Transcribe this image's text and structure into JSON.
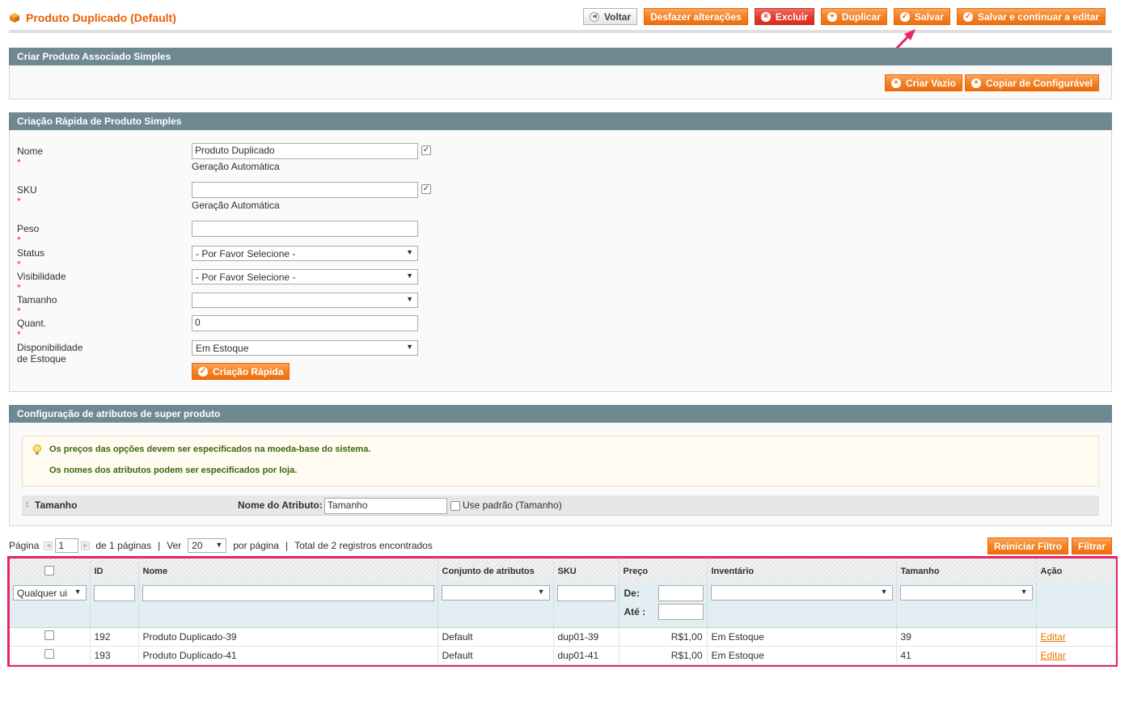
{
  "header": {
    "title": "Produto Duplicado (Default)",
    "buttons": {
      "back": "Voltar",
      "reset": "Desfazer alterações",
      "delete": "Excluir",
      "duplicate": "Duplicar",
      "save": "Salvar",
      "save_continue": "Salvar e continuar a editar"
    }
  },
  "associated": {
    "title": "Criar Produto Associado Simples",
    "create_empty": "Criar Vazio",
    "copy_configurable": "Copiar de Configurável"
  },
  "quick": {
    "title": "Criação Rápida de Produto Simples",
    "required_mark": "*",
    "name_label": "Nome",
    "name_value": "Produto Duplicado",
    "auto_gen": "Geração Automática",
    "sku_label": "SKU",
    "sku_value": "",
    "weight_label": "Peso",
    "status_label": "Status",
    "status_value": "- Por Favor Selecione -",
    "visibility_label": "Visibilidade",
    "visibility_value": "- Por Favor Selecione -",
    "size_label": "Tamanho",
    "size_value": "",
    "qty_label": "Quant.",
    "qty_value": "0",
    "stock_label": "Disponibilidade de Estoque",
    "stock_value": "Em Estoque",
    "submit": "Criação Rápida"
  },
  "super": {
    "title": "Configuração de atributos de super produto",
    "notice_1": "Os preços das opções devem ser especificados na moeda-base do sistema.",
    "notice_2": "Os nomes dos atributos podem ser especificados por loja.",
    "attr_name": "Tamanho",
    "attr_label_caption": "Nome do Atributo:",
    "attr_label_value": "Tamanho",
    "use_default": "Use padrão (Tamanho)"
  },
  "pager": {
    "page_label": "Página",
    "page_value": "1",
    "of_pages": "de 1 páginas",
    "sep": "|",
    "view_label": "Ver",
    "per_page_value": "20",
    "per_page": "por página",
    "total": "Total de 2 registros encontrados",
    "reset_filter": "Reiniciar Filtro",
    "filter": "Filtrar"
  },
  "grid": {
    "columns": [
      "ID",
      "Nome",
      "Conjunto de atributos",
      "SKU",
      "Preço",
      "Inventário",
      "Tamanho",
      "Ação"
    ],
    "filter_any": "Qualquer ui",
    "price_from": "De:",
    "price_to": "Até :",
    "rows": [
      {
        "id": "192",
        "name": "Produto Duplicado-39",
        "set": "Default",
        "sku": "dup01-39",
        "price": "R$1,00",
        "inventory": "Em Estoque",
        "size": "39",
        "action": "Editar"
      },
      {
        "id": "193",
        "name": "Produto Duplicado-41",
        "set": "Default",
        "sku": "dup01-41",
        "price": "R$1,00",
        "inventory": "Em Estoque",
        "size": "41",
        "action": "Editar"
      }
    ]
  },
  "colors": {
    "accent": "#eb5e00",
    "section_header": "#6f8992",
    "highlight_box": "#e6236c",
    "arrow": "#e6236c"
  }
}
